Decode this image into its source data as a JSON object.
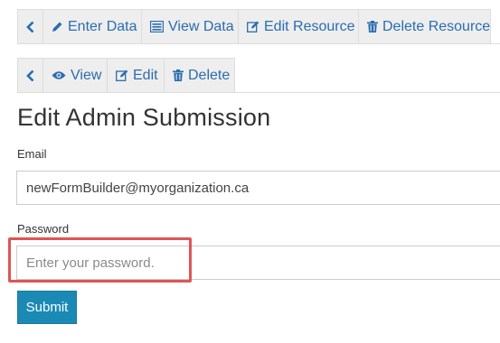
{
  "top_tabs": [
    {
      "label": "Enter Data",
      "icon": "pencil-icon"
    },
    {
      "label": "View Data",
      "icon": "list-icon"
    },
    {
      "label": "Edit Resource",
      "icon": "edit-icon"
    },
    {
      "label": "Delete Resource",
      "icon": "trash-icon"
    }
  ],
  "sub_tabs": [
    {
      "label": "View",
      "icon": "eye-icon"
    },
    {
      "label": "Edit",
      "icon": "edit-icon"
    },
    {
      "label": "Delete",
      "icon": "trash-icon"
    }
  ],
  "page": {
    "title": "Edit Admin Submission"
  },
  "form": {
    "email_label": "Email",
    "email_value": "newFormBuilder@myorganization.ca",
    "password_label": "Password",
    "password_placeholder": "Enter your password.",
    "submit_label": "Submit"
  },
  "colors": {
    "link": "#2a6cb0",
    "tab_bg": "#eeeeee",
    "submit_bg": "#1a8ab5",
    "highlight": "#e05555"
  }
}
